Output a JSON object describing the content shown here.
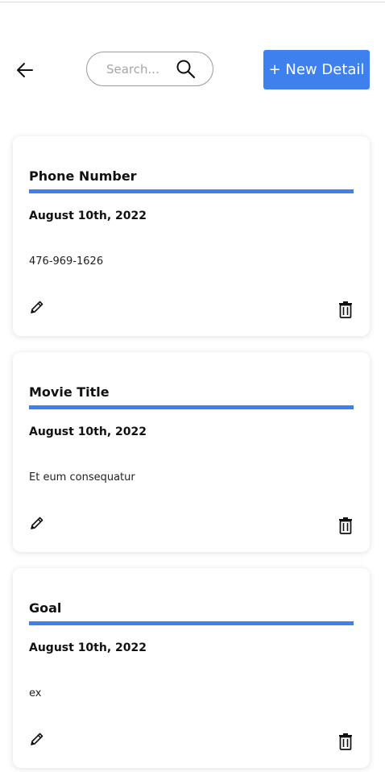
{
  "header": {
    "back_icon": "arrow-left-icon",
    "search": {
      "placeholder": "Search...",
      "value": "",
      "icon": "search-icon"
    },
    "new_button_label": "+ New Detail"
  },
  "colors": {
    "accent": "#3f80ef",
    "text": "#111111",
    "card_bg": "#ffffff"
  },
  "cards": [
    {
      "title": "Phone Number",
      "date": "August 10th, 2022",
      "value": "476-969-1626",
      "edit_icon": "pencil-icon",
      "delete_icon": "trash-icon"
    },
    {
      "title": "Movie Title",
      "date": "August 10th, 2022",
      "value": "Et eum consequatur",
      "edit_icon": "pencil-icon",
      "delete_icon": "trash-icon"
    },
    {
      "title": "Goal",
      "date": "August 10th, 2022",
      "value": "ex",
      "edit_icon": "pencil-icon",
      "delete_icon": "trash-icon"
    }
  ]
}
